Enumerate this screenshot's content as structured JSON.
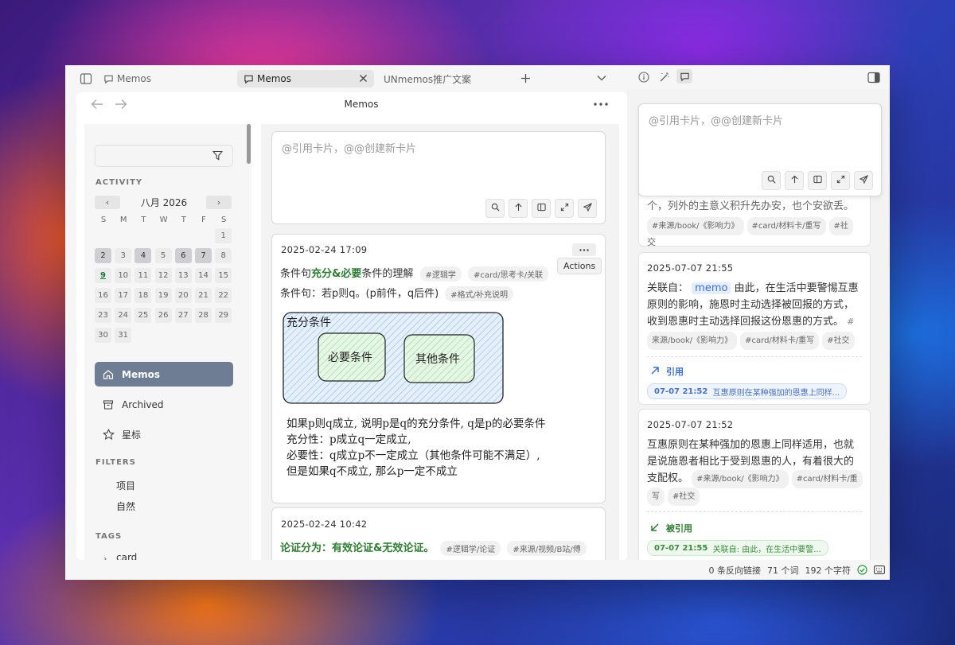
{
  "tabs": {
    "pinned_label": "Memos",
    "active_label": "Memos",
    "other_label": "UNmemos推广文案"
  },
  "header": {
    "title": "Memos"
  },
  "sidebar": {
    "search_placeholder": "",
    "activity_label": "ACTIVITY",
    "calendar": {
      "month_title": "八月 2026",
      "weekdays": [
        "S",
        "M",
        "T",
        "W",
        "T",
        "F",
        "S"
      ],
      "days": [
        "1",
        "2",
        "3",
        "4",
        "5",
        "6",
        "7",
        "8",
        "9",
        "10",
        "11",
        "12",
        "13",
        "14",
        "15",
        "16",
        "17",
        "18",
        "19",
        "20",
        "21",
        "22",
        "23",
        "24",
        "25",
        "26",
        "27",
        "28",
        "29",
        "30",
        "31"
      ]
    },
    "nav": {
      "memos": "Memos",
      "archived": "Archived",
      "starred": "星标"
    },
    "filters_label": "FILTERS",
    "filters": [
      "项目",
      "自然"
    ],
    "tags_label": "TAGS",
    "tags": [
      "card"
    ]
  },
  "editor": {
    "placeholder": "@引用卡片，@@创建新卡片"
  },
  "cards": [
    {
      "date": "2025-02-24 17:09",
      "line1_pre": "条件句",
      "line1_green": "充分&必要",
      "line1_post": "条件的理解",
      "line1_tags": [
        "#逻辑学",
        "#card/思考卡/关联"
      ],
      "line2": "条件句：若p则q。(p前件，q后件)",
      "line2_tags": [
        "#格式/补充说明"
      ],
      "diagram": {
        "outer": "充分条件",
        "inner1": "必要条件",
        "inner2": "其他条件"
      },
      "handwriting": [
        "如果p则q成立, 说明p是q的充分条件, q是p的必要条件",
        "充分性：p成立q一定成立,",
        "必要性：q成立p不一定成立（其他条件可能不满足）,",
        "但是如果q不成立, 那么p一定不成立"
      ],
      "actions_tooltip": "Actions"
    },
    {
      "date": "2025-02-24 10:42",
      "line1_green": "论证分为：有效论证&无效论证。",
      "line1_tags": [
        "#逻辑学/论证",
        "#来源/视频/B站/傅"
      ]
    }
  ],
  "right": {
    "editor_placeholder": "@引用卡片，@@创建新卡片",
    "top_card": {
      "partial_text": "个，列外的主意义积升先办安，也个安欲丢。",
      "tags": [
        "#来源/book/《影响力》",
        "#card/材料卡/重写",
        "#社"
      ],
      "tail": "交"
    },
    "card1": {
      "date": "2025-07-07 21:55",
      "text_pre": "关联自：",
      "memo_link": "memo",
      "text_l1": " 由此，在生活中要警惕互惠",
      "text_l2": "原则的影响，施恩时主动选择被回报的方式，",
      "text_l3": "收到恩惠时主动选择回报这份恩惠的方式。",
      "tag_frag": "#",
      "tags": [
        "来源/book/《影响力》",
        "#card/材料卡/重写",
        "#社交"
      ],
      "ref_head": "引用",
      "ref_time": "07-07 21:52",
      "ref_text": "互惠原则在某种强加的恩惠上同样..."
    },
    "card2": {
      "date": "2025-07-07 21:52",
      "text_l1": "互惠原则在某种强加的恩惠上同样适用，也就",
      "text_l2": "是说施恩者相比于受到恩惠的人，有着很大的",
      "text_l3": "支配权。",
      "tags_l3": [
        "#来源/book/《影响力》",
        "#card/材料卡/重"
      ],
      "tags_l4": [
        "写",
        "#社交"
      ],
      "ref_head": "被引用",
      "ref_time": "07-07 21:55",
      "ref_text": "关联自: 由此，在生活中要警..."
    }
  },
  "status": {
    "backlinks": "0 条反向链接",
    "words": "71 个词",
    "chars": "192 个字符"
  }
}
